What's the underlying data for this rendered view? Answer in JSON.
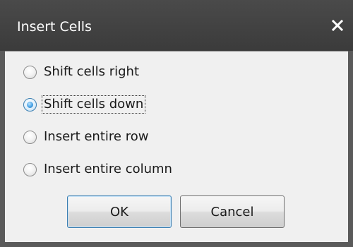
{
  "window": {
    "title": "Insert Cells",
    "close_icon": "close-icon"
  },
  "options": [
    {
      "label": "Shift cells right",
      "checked": false
    },
    {
      "label": "Shift cells down",
      "checked": true
    },
    {
      "label": "Insert entire row",
      "checked": false
    },
    {
      "label": "Insert entire column",
      "checked": false
    }
  ],
  "buttons": {
    "ok_label": "OK",
    "cancel_label": "Cancel"
  },
  "colors": {
    "titlebar": "#3b3b3b",
    "client": "#f0f0f0",
    "accent": "#3c7fb1"
  }
}
